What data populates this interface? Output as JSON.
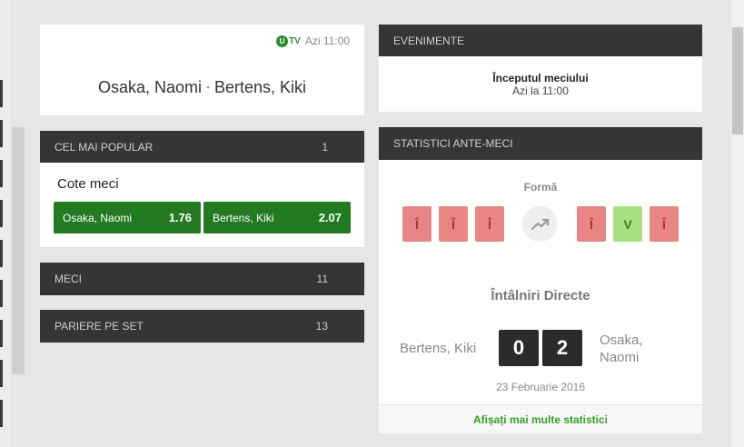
{
  "match": {
    "tv_label": "TV",
    "tv_letter": "U",
    "time": "Azi 11:00",
    "player1": "Osaka, Naomi",
    "separator": "-",
    "player2": "Bertens, Kiki"
  },
  "popular": {
    "label": "CEL MAI POPULAR",
    "count": "1",
    "market_title": "Cote meci",
    "odds": [
      {
        "name": "Osaka, Naomi",
        "price": "1.76"
      },
      {
        "name": "Bertens, Kiki",
        "price": "2.07"
      }
    ]
  },
  "sections": [
    {
      "label": "MECI",
      "count": "11"
    },
    {
      "label": "PARIERE PE SET",
      "count": "13"
    }
  ],
  "events": {
    "label": "EVENIMENTE",
    "title": "Începutul meciului",
    "time": "Azi la 11:00"
  },
  "stats": {
    "label": "STATISTICI ANTE-MECI",
    "form_label": "Formă",
    "form_left": [
      "Î",
      "Î",
      "Î"
    ],
    "form_right": [
      "Î",
      "V",
      "Î"
    ],
    "h2h_title": "Întâlniri Directe",
    "h2h_left_player": "Bertens, Kiki",
    "h2h_right_player": "Osaka, Naomi",
    "score_left": "0",
    "score_right": "2",
    "date": "23 Februarie 2016",
    "more_link": "Afișați mai multe statistici"
  },
  "colors": {
    "accent_green": "#237a23",
    "dark_header": "#353535",
    "loss": "#e88585",
    "win": "#a8df7f"
  }
}
